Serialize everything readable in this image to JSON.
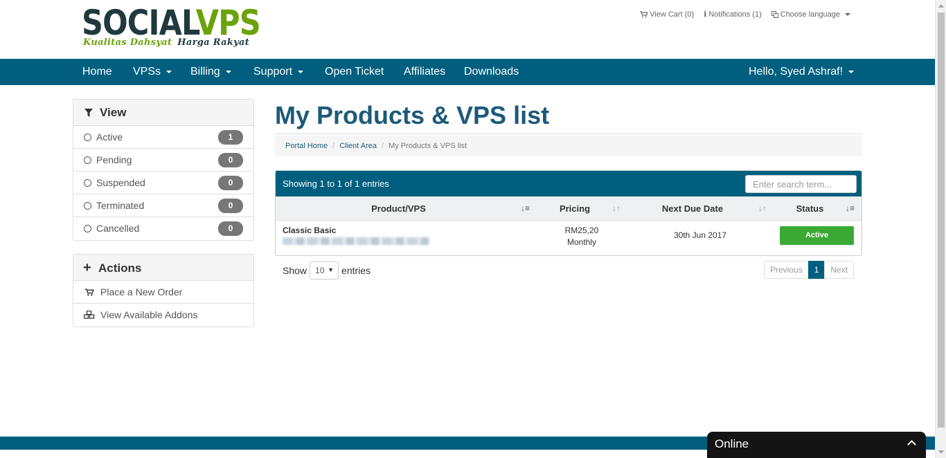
{
  "brand": {
    "logo_part1": "SOCIAL",
    "logo_part2": "VPS",
    "tagline_part1": "Kualitas Dahsyat",
    "tagline_part2": "Harga Rakyat",
    "colors": {
      "dark": "#1f3a3d",
      "green": "#6aa30a"
    }
  },
  "toplinks": {
    "cart": "View Cart (0)",
    "notifications": "Notifications (1)",
    "language": "Choose language"
  },
  "nav": {
    "home": "Home",
    "vpss": "VPSs",
    "billing": "Billing",
    "support": "Support",
    "open_ticket": "Open Ticket",
    "affiliates": "Affiliates",
    "downloads": "Downloads",
    "user": "Hello, Syed Ashraf!",
    "color": "#005f7f"
  },
  "sidebar": {
    "view_title": "View",
    "filters": [
      {
        "label": "Active",
        "count": "1"
      },
      {
        "label": "Pending",
        "count": "0"
      },
      {
        "label": "Suspended",
        "count": "0"
      },
      {
        "label": "Terminated",
        "count": "0"
      },
      {
        "label": "Cancelled",
        "count": "0"
      }
    ],
    "actions_title": "Actions",
    "actions": [
      {
        "label": "Place a New Order",
        "icon": "cart-icon"
      },
      {
        "label": "View Available Addons",
        "icon": "cubes-icon"
      }
    ]
  },
  "main": {
    "title": "My Products & VPS list",
    "breadcrumb": [
      "Portal Home",
      "Client Area",
      "My Products & VPS list"
    ],
    "table": {
      "info": "Showing 1 to 1 of 1 entries",
      "search_placeholder": "Enter search term...",
      "columns": [
        "Product/VPS",
        "Pricing",
        "Next Due Date",
        "Status"
      ],
      "rows": [
        {
          "product": "Classic Basic",
          "price": "RM25,20",
          "cycle": "Monthly",
          "due": "30th Jun 2017",
          "status": "Active"
        }
      ],
      "status_color": "#3aaa35"
    },
    "length": {
      "show": "Show",
      "value": "10",
      "entries": "entries"
    },
    "pager": {
      "previous": "Previous",
      "current": "1",
      "next": "Next"
    }
  },
  "chat": {
    "label": "Online"
  }
}
